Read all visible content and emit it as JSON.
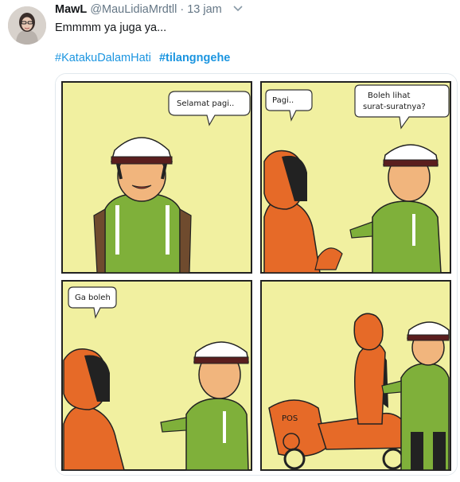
{
  "tweet": {
    "display_name": "MawL",
    "handle": "@MauLidiaMrdtll",
    "separator": "·",
    "time": "13 jam",
    "text": "Emmmm ya juga ya...",
    "hashtags": [
      {
        "text": "#KatakuDalamHati",
        "bold": false
      },
      {
        "text": "#tilangngehe",
        "bold": true
      }
    ]
  },
  "comic": {
    "panel1": {
      "bubble": "Selamat pagi.."
    },
    "panel2": {
      "bubble_left": "Pagi..",
      "bubble_right_line1": "Boleh lihat",
      "bubble_right_line2": "surat-suratnya?"
    },
    "panel3": {
      "bubble": "Ga boleh"
    },
    "panel4": {
      "scooter_label": "POS"
    }
  },
  "colors": {
    "link": "#1b95e0",
    "panel_bg": "#f1f0a0",
    "vest": "#7fb03a",
    "helmet": "#e66a28"
  },
  "icons": {
    "menu": "chevron-down-icon"
  }
}
